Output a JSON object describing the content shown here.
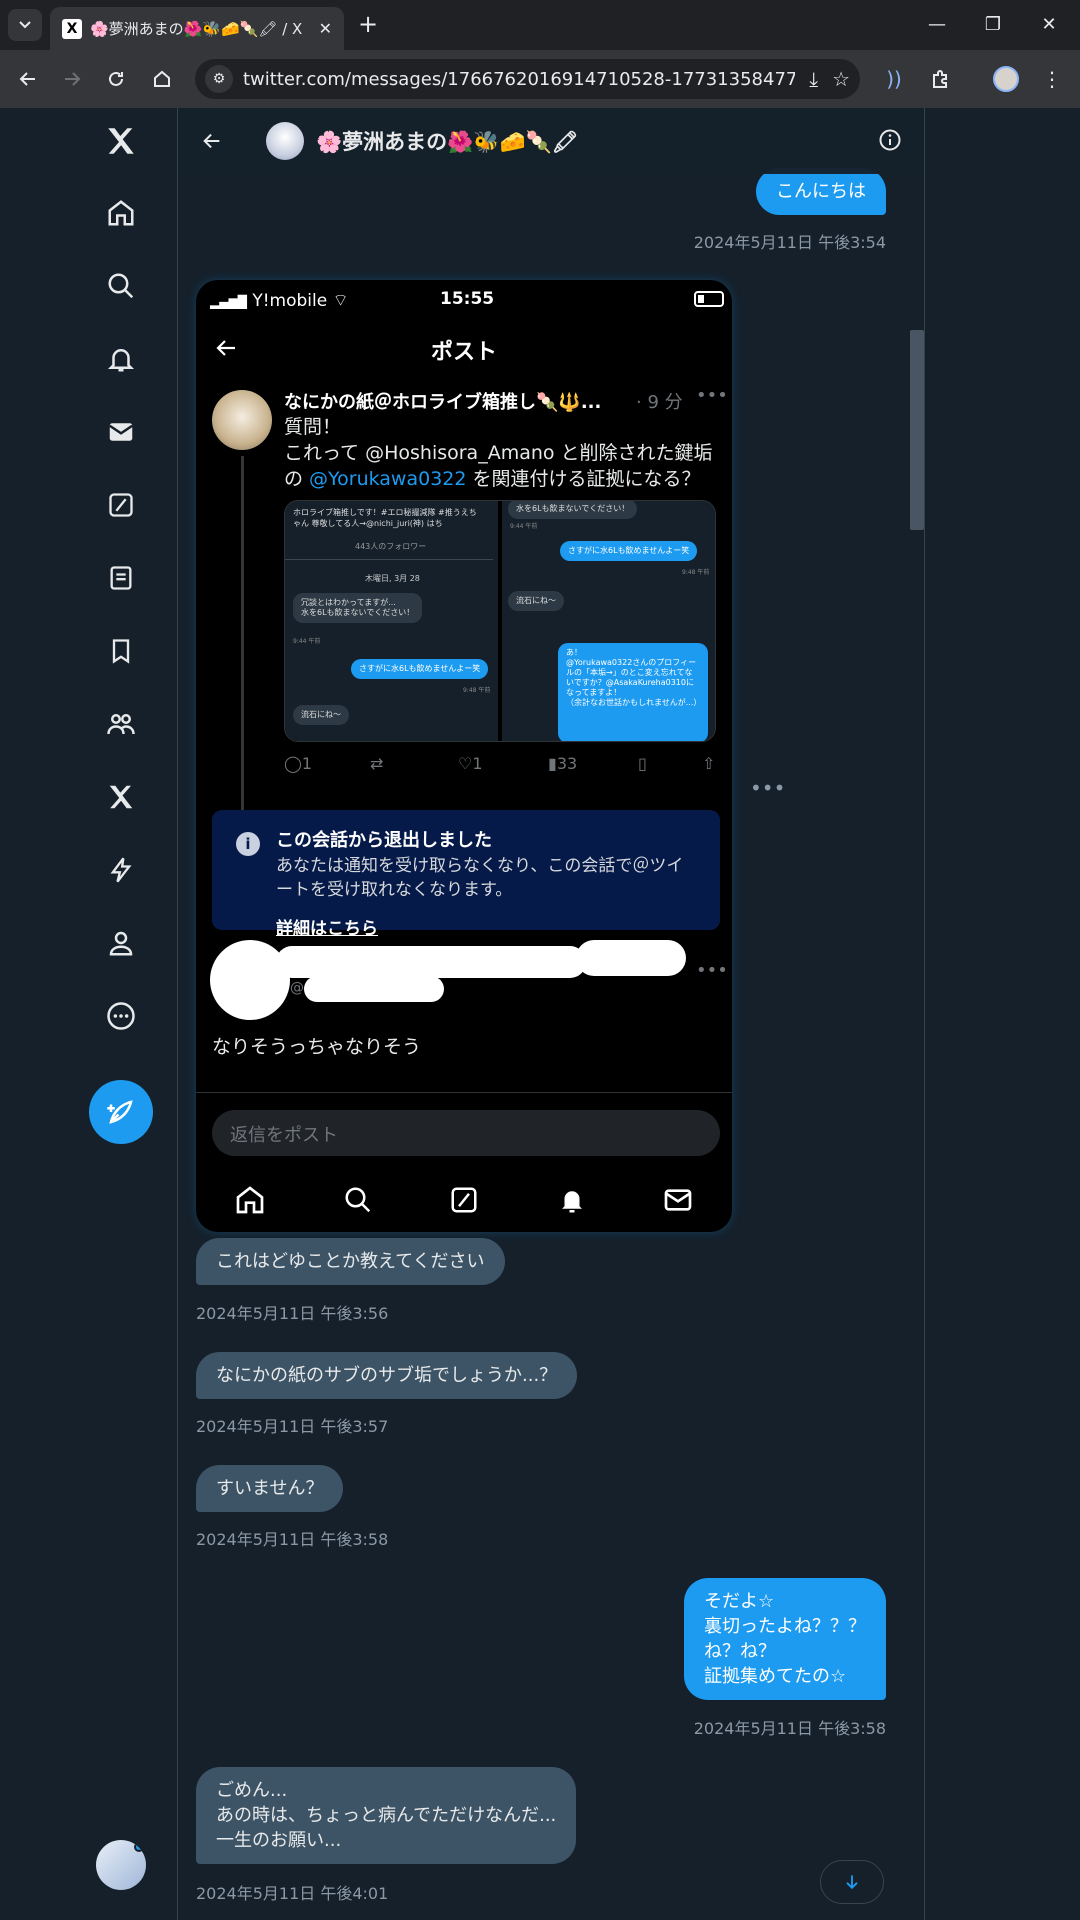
{
  "browser": {
    "tab_title": "🌸夢洲あまの🌺🐝🧀🍡🖍 / X",
    "tab_favicon": "X",
    "url": "twitter.com/messages/1766762016914710528-1773135847753461..."
  },
  "conversation": {
    "name": "🌸夢洲あまの🌺🐝🧀🍡🖍"
  },
  "messages": [
    {
      "text": "こんにちは",
      "time": "2024年5月11日 午後3:54"
    },
    {
      "text": "これはどゆことか教えてください",
      "time": "2024年5月11日 午後3:56"
    },
    {
      "text": "なにかの紙のサブのサブ垢でしょうか...？",
      "time": "2024年5月11日 午後3:57"
    },
    {
      "text": "すいません？",
      "time": "2024年5月11日 午後3:58"
    },
    {
      "text": "そだよ☆\n裏切ったよね？？？\nね？ね？\n証拠集めてたの☆",
      "time": "2024年5月11日 午後3:58"
    },
    {
      "text": "ごめん...\nあの時は、ちょっと病んでただけなんだ...\n一生のお願い...",
      "time": "2024年5月11日 午後4:01"
    }
  ],
  "screenshot": {
    "carrier": "Y!mobile",
    "time": "15:55",
    "header_title": "ポスト",
    "tweet": {
      "name": "なにかの紙＠ホロライブ箱推し🍡🔱...",
      "ago": "· 9 分",
      "line1": "質問！",
      "line2_pre": "これって @Hoshisora_Amano と削除された鍵垢",
      "line3_pre": "の ",
      "line3_mention": "@Yorukawa0322",
      "line3_post": " を関連付ける証拠になる？",
      "replies": "1",
      "likes": "1",
      "views": "33"
    },
    "image_left": {
      "profile_line": "ホロライブ箱推しです！#エロ秘撮減隊 #推うえちゃん 尊敬してる人→@nichi_juri(神) はち",
      "followers": "443人のフォロワー",
      "date": "木曜日, 3月 28",
      "b1": "冗談とはわかってますが...\n水を6Lも飲まないでください！",
      "b2": "さすがに水6Lも飲めませんよー笑",
      "b3": "流石にね〜",
      "t1": "9:44 午前",
      "t2": "9:48 午前"
    },
    "image_right": {
      "b0": "水を6Lも飲まないでください！",
      "b1": "さすがに水6Lも飲めませんよー笑",
      "b2": "流石にね〜",
      "b3": "あ！\n@Yorukawa0322さんのプロフィールの「本垢→」のとこ変え忘れてないですか？@AsakaKureha0310になってますよ！\n（余計なお世話かもしれませんが...）",
      "t1": "9:44 午前",
      "t2": "9:48 午前"
    },
    "notice": {
      "heading": "この会話から退出しました",
      "body": "あなたは通知を受け取らなくなり、この会話で＠ツイートを受け取れなくなります。",
      "link": "詳細はこちら"
    },
    "reply_text": "なりそうっちゃなりそう",
    "reply_placeholder": "返信をポスト",
    "at_glyph": "@"
  },
  "colors": {
    "background": "#15202b",
    "accent": "#1d9bf0",
    "incoming_bubble": "#3d5466",
    "timestamp": "#8b98a5"
  },
  "icons": [
    "home-icon",
    "search-icon",
    "bell-icon",
    "mail-icon",
    "grok-icon",
    "lists-icon",
    "bookmark-icon",
    "communities-icon",
    "premium-icon",
    "verified-orgs-icon",
    "profile-icon",
    "more-icon",
    "compose-icon",
    "back-arrow-icon",
    "info-icon",
    "scroll-down-icon"
  ]
}
